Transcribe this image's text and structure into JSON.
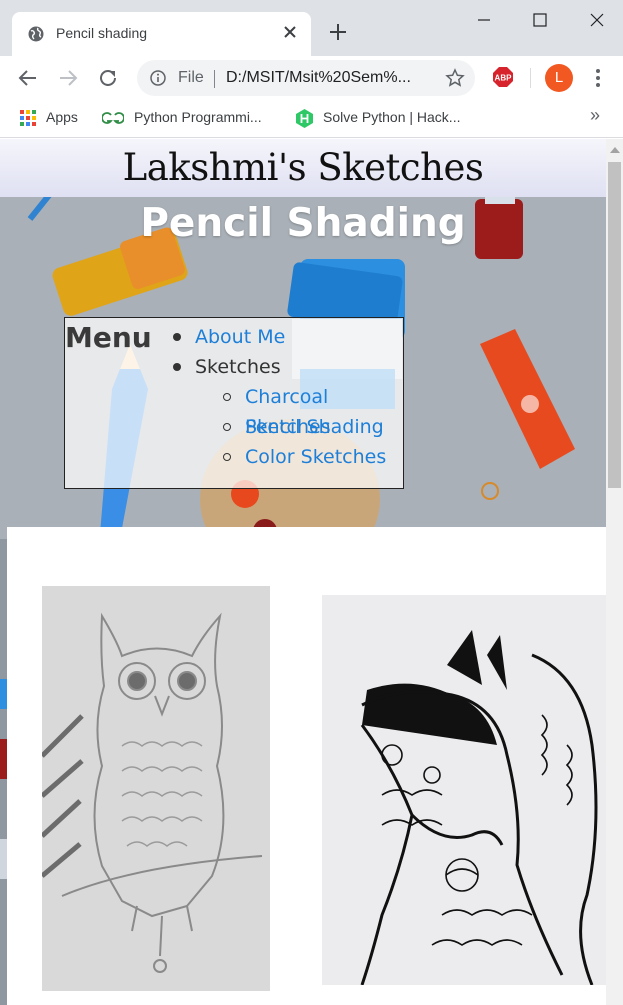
{
  "browser": {
    "tab_title": "Pencil shading",
    "omnibox_scheme": "File",
    "omnibox_url": "D:/MSIT/Msit%20Sem%...",
    "profile_initial": "L",
    "abp_label": "ABP",
    "bookmarks": [
      {
        "label": "Apps",
        "icon": "apps-grid-icon"
      },
      {
        "label": "Python Programmi...",
        "icon": "geeksforgeeks-icon"
      },
      {
        "label": "Solve Python | Hack...",
        "icon": "hackerrank-icon"
      }
    ],
    "bookmarks_more": "»",
    "accent_color": "#1e7fd8",
    "profile_color": "#f25822"
  },
  "page": {
    "site_title": "Lakshmi's Sketches",
    "heading": "Pencil Shading",
    "menu": {
      "label": "Menu",
      "items": [
        {
          "label": "About Me",
          "link": true
        },
        {
          "label": "Sketches",
          "link": false
        },
        {
          "label": "Charcoal Sketches",
          "link": true
        },
        {
          "label": "Pencil Shading",
          "link": true
        },
        {
          "label": "Color Sketches",
          "link": true
        }
      ]
    },
    "gallery": {
      "images": [
        {
          "name": "owl-pencil-sketch",
          "subject": "owl"
        },
        {
          "name": "wolf-zentangle-sketch",
          "subject": "wolf"
        }
      ]
    }
  }
}
